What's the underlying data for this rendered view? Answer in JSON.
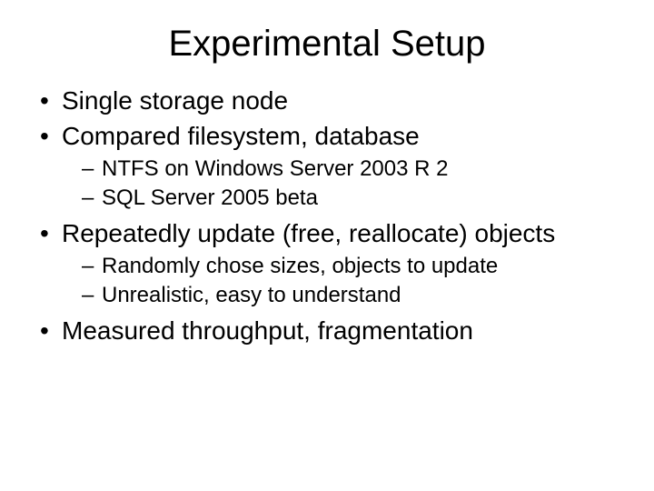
{
  "title": "Experimental Setup",
  "bullets": [
    {
      "text": "Single storage node",
      "children": []
    },
    {
      "text": "Compared filesystem, database",
      "children": [
        "NTFS on Windows Server 2003 R 2",
        "SQL Server 2005 beta"
      ]
    },
    {
      "text": "Repeatedly update (free, reallocate) objects",
      "children": [
        "Randomly chose sizes, objects to update",
        "Unrealistic, easy to understand"
      ]
    },
    {
      "text": "Measured throughput, fragmentation",
      "children": []
    }
  ]
}
